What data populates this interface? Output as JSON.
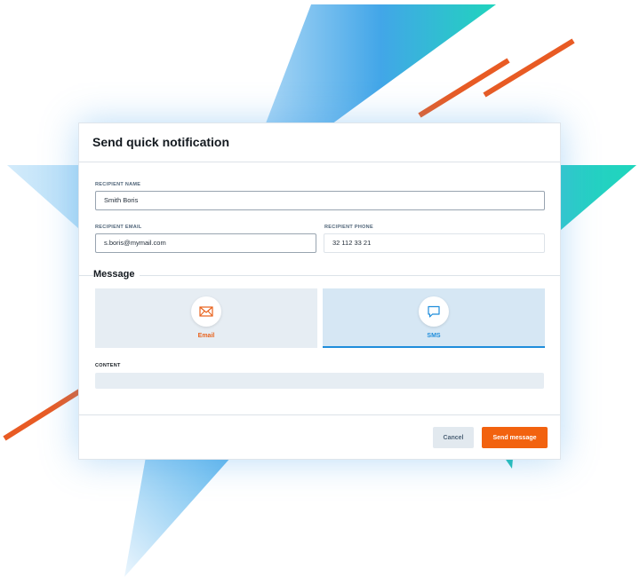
{
  "dialog": {
    "title": "Send quick notification",
    "recipient_name": {
      "label": "RECIPIENT NAME",
      "value": "Smith Boris"
    },
    "recipient_email": {
      "label": "RECIPIENT EMAIL",
      "value": "s.boris@mymail.com"
    },
    "recipient_phone": {
      "label": "RECIPIENT PHONE",
      "value": "32 112 33 21"
    },
    "message_section": "Message",
    "channels": [
      {
        "label": "Email",
        "icon": "envelope-icon",
        "color": "#e8621c",
        "selected": false
      },
      {
        "label": "SMS",
        "icon": "chat-bubble-icon",
        "color": "#1f8ddb",
        "selected": true
      }
    ],
    "content_label": "CONTENT",
    "content_value": "",
    "cancel_label": "Cancel",
    "send_label": "Send message"
  },
  "colors": {
    "accent": "#f2620f",
    "selected": "#1f8ddb",
    "teal": "#22d3bf"
  }
}
